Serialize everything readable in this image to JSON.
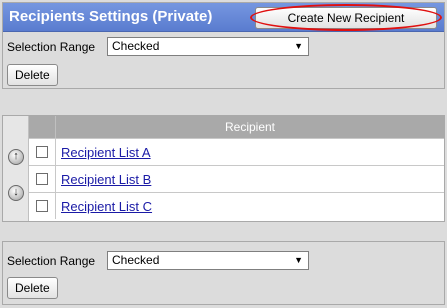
{
  "header": {
    "title": "Recipients Settings (Private)",
    "create_label": "Create New Recipient"
  },
  "top_controls": {
    "selection_label": "Selection Range",
    "selection_value": "Checked",
    "delete_label": "Delete"
  },
  "list": {
    "column_header": "Recipient",
    "items": [
      {
        "label": "Recipient List A",
        "checked": false
      },
      {
        "label": "Recipient List B",
        "checked": false
      },
      {
        "label": "Recipient List C",
        "checked": false
      }
    ]
  },
  "bottom_controls": {
    "selection_label": "Selection Range",
    "selection_value": "Checked",
    "delete_label": "Delete"
  },
  "icons": {
    "move_up": "arrow-up-icon",
    "move_down": "arrow-down-icon",
    "dropdown": "chevron-down-icon"
  },
  "colors": {
    "title_bar": "#6687d8",
    "highlight_ellipse": "#e01010",
    "link": "#1a1aa6",
    "table_header": "#a9a9a9"
  }
}
